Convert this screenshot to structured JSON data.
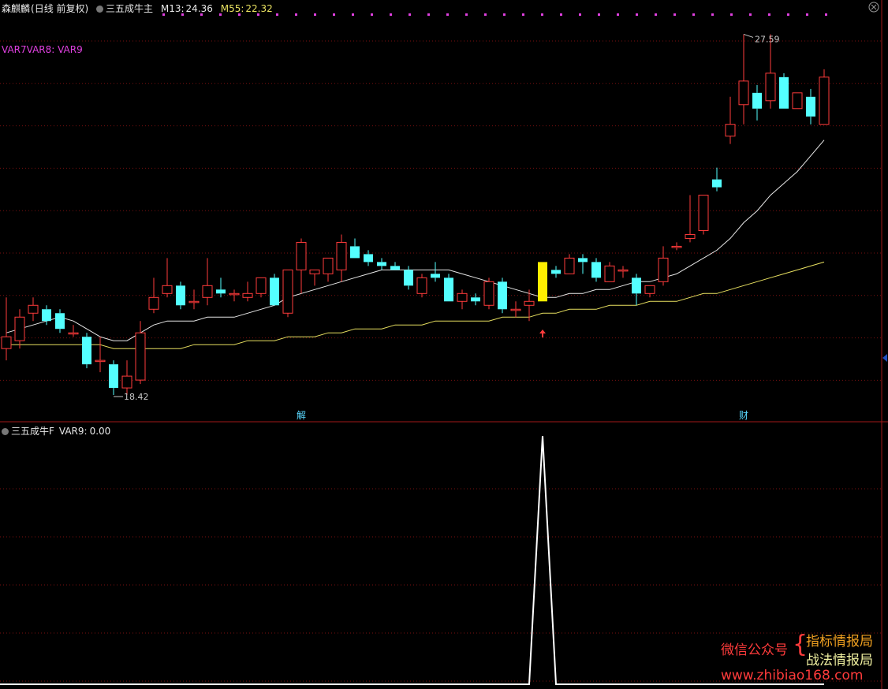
{
  "main_panel": {
    "stock_name": "森麒麟",
    "period": "(日线 前复权)",
    "indicator_name": "三五成牛主",
    "ma13": {
      "label": "M13:",
      "value": "24.36",
      "color": "#e8e8e8"
    },
    "ma55": {
      "label": "M55:",
      "value": "22.32",
      "color": "#e8e060"
    },
    "var_line": "VAR7VAR8: VAR9",
    "var_line_color": "#e040e0"
  },
  "sub_panel": {
    "indicator_name": "三五成牛F",
    "var9": {
      "label": "VAR9:",
      "value": "0.00"
    }
  },
  "watermark": {
    "wechat": "微信公众号",
    "line1": "指标情报局",
    "line2": "战法情报局",
    "url": "www.zhibiao168.com"
  },
  "colors": {
    "up": "#ff3b3b",
    "down": "#54ffff",
    "signal": "#ffee00",
    "grid": "#7a1010",
    "dots": "#e040e0"
  },
  "chart_data": [
    {
      "type": "candlestick",
      "ohlc": [
        [
          19.6,
          19.3,
          20.9,
          19.9
        ],
        [
          19.8,
          19.6,
          20.6,
          20.4
        ],
        [
          20.5,
          20.3,
          20.9,
          20.7
        ],
        [
          20.6,
          20.2,
          20.7,
          20.3
        ],
        [
          20.5,
          20.0,
          20.6,
          20.1
        ],
        [
          20.0,
          19.9,
          20.2,
          20.0
        ],
        [
          19.9,
          19.1,
          20.0,
          19.2
        ],
        [
          19.3,
          19.0,
          19.9,
          19.3
        ],
        [
          19.2,
          18.42,
          19.3,
          18.6
        ],
        [
          18.6,
          18.42,
          19.3,
          18.9
        ],
        [
          18.8,
          18.7,
          20.3,
          20.0
        ],
        [
          20.6,
          20.5,
          21.4,
          20.9
        ],
        [
          21.0,
          20.9,
          21.9,
          21.2
        ],
        [
          21.2,
          20.6,
          21.3,
          20.7
        ],
        [
          20.8,
          20.6,
          21.1,
          20.8
        ],
        [
          20.9,
          20.7,
          21.9,
          21.2
        ],
        [
          21.1,
          20.9,
          21.4,
          21.0
        ],
        [
          21.0,
          20.8,
          21.1,
          21.0
        ],
        [
          20.9,
          20.8,
          21.3,
          21.0
        ],
        [
          21.0,
          20.9,
          21.3,
          21.4
        ],
        [
          21.4,
          20.7,
          21.5,
          20.7
        ],
        [
          20.5,
          20.4,
          21.6,
          21.6
        ],
        [
          21.6,
          21.0,
          22.4,
          22.3
        ],
        [
          21.5,
          21.2,
          21.6,
          21.6
        ],
        [
          21.5,
          21.3,
          21.9,
          21.9
        ],
        [
          21.6,
          21.3,
          22.5,
          22.3
        ],
        [
          22.2,
          21.9,
          22.4,
          21.9
        ],
        [
          22.0,
          21.7,
          22.1,
          21.8
        ],
        [
          21.8,
          21.6,
          21.9,
          21.7
        ],
        [
          21.7,
          21.6,
          21.8,
          21.6
        ],
        [
          21.6,
          21.1,
          21.7,
          21.2
        ],
        [
          21.0,
          20.9,
          21.5,
          21.4
        ],
        [
          21.5,
          21.3,
          21.8,
          21.4
        ],
        [
          21.4,
          20.8,
          21.5,
          20.8
        ],
        [
          20.8,
          20.6,
          21.1,
          21.0
        ],
        [
          20.9,
          20.7,
          21.0,
          20.8
        ],
        [
          20.7,
          20.6,
          21.4,
          21.3
        ],
        [
          21.3,
          20.5,
          21.4,
          20.6
        ],
        [
          20.6,
          20.4,
          20.8,
          20.6
        ],
        [
          20.7,
          20.3,
          21.1,
          20.8
        ],
        [
          20.8,
          20.8,
          21.8,
          21.8
        ],
        [
          21.6,
          21.4,
          21.7,
          21.5
        ],
        [
          21.5,
          21.5,
          22.0,
          21.9
        ],
        [
          21.9,
          21.5,
          22.0,
          21.8
        ],
        [
          21.8,
          21.3,
          21.9,
          21.4
        ],
        [
          21.3,
          21.3,
          21.8,
          21.7
        ],
        [
          21.6,
          21.4,
          21.7,
          21.6
        ],
        [
          21.4,
          20.7,
          21.5,
          21.0
        ],
        [
          21.0,
          20.9,
          21.1,
          21.2
        ],
        [
          21.3,
          21.2,
          22.2,
          21.9
        ],
        [
          22.2,
          22.1,
          22.3,
          22.2
        ],
        [
          22.4,
          22.3,
          23.5,
          22.5
        ],
        [
          22.6,
          22.5,
          23.3,
          23.5
        ],
        [
          23.9,
          23.6,
          24.2,
          23.7
        ],
        [
          25.0,
          24.8,
          26.0,
          25.3
        ],
        [
          25.8,
          25.3,
          27.59,
          26.4
        ],
        [
          26.1,
          25.4,
          26.3,
          25.7
        ],
        [
          25.9,
          25.7,
          27.59,
          26.6
        ],
        [
          26.5,
          25.7,
          26.6,
          25.7
        ],
        [
          25.7,
          25.7,
          26.1,
          26.1
        ],
        [
          26.0,
          25.3,
          26.2,
          25.5
        ],
        [
          25.3,
          25.3,
          26.7,
          26.5
        ]
      ],
      "signal_candle_index": 40,
      "ma13": [
        20.0,
        20.1,
        20.2,
        20.3,
        20.4,
        20.3,
        20.1,
        19.9,
        19.8,
        19.8,
        20.0,
        20.2,
        20.3,
        20.3,
        20.3,
        20.4,
        20.4,
        20.4,
        20.5,
        20.6,
        20.7,
        20.9,
        21.0,
        21.1,
        21.2,
        21.3,
        21.4,
        21.5,
        21.6,
        21.6,
        21.6,
        21.6,
        21.6,
        21.6,
        21.5,
        21.4,
        21.3,
        21.2,
        21.1,
        21.0,
        20.9,
        20.9,
        21.0,
        21.0,
        21.1,
        21.1,
        21.2,
        21.3,
        21.3,
        21.4,
        21.5,
        21.7,
        21.9,
        22.1,
        22.4,
        22.8,
        23.1,
        23.5,
        23.8,
        24.1,
        24.5,
        24.9
      ],
      "ma55": [
        19.7,
        19.7,
        19.7,
        19.7,
        19.7,
        19.7,
        19.7,
        19.7,
        19.6,
        19.6,
        19.6,
        19.6,
        19.6,
        19.6,
        19.7,
        19.7,
        19.7,
        19.7,
        19.8,
        19.8,
        19.8,
        19.9,
        19.9,
        19.9,
        20.0,
        20.0,
        20.1,
        20.1,
        20.1,
        20.2,
        20.2,
        20.2,
        20.3,
        20.3,
        20.3,
        20.3,
        20.3,
        20.4,
        20.4,
        20.4,
        20.5,
        20.5,
        20.6,
        20.6,
        20.6,
        20.7,
        20.7,
        20.7,
        20.8,
        20.8,
        20.8,
        20.9,
        21.0,
        21.0,
        21.1,
        21.2,
        21.3,
        21.4,
        21.5,
        21.6,
        21.7,
        21.8
      ],
      "high_label": "27.59",
      "low_label": "18.42",
      "markers": [
        {
          "index": 22,
          "text": "解"
        },
        {
          "index": 55,
          "text": "财"
        }
      ],
      "ylim": [
        17.8,
        28.1
      ]
    },
    {
      "type": "line",
      "series_var9": [
        0,
        0,
        0,
        0,
        0,
        0,
        0,
        0,
        0,
        0,
        0,
        0,
        0,
        0,
        0,
        0,
        0,
        0,
        0,
        0,
        0,
        0,
        0,
        0,
        0,
        0,
        0,
        0,
        0,
        0,
        0,
        0,
        0,
        0,
        0,
        0,
        0,
        0,
        0,
        0,
        1,
        0,
        0,
        0,
        0,
        0,
        0,
        0,
        0,
        0,
        0,
        0,
        0,
        0,
        0,
        0,
        0,
        0,
        0,
        0,
        0,
        0
      ],
      "ylim": [
        0,
        1
      ]
    }
  ]
}
